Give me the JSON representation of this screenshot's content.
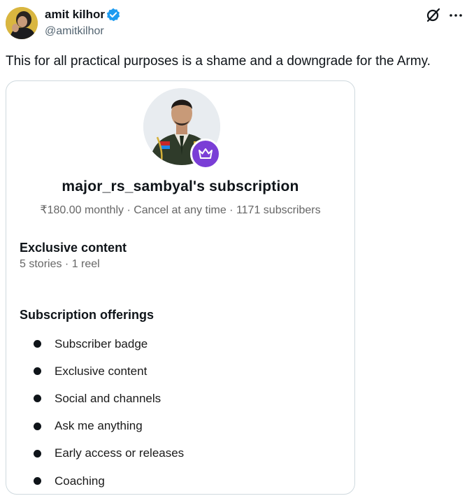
{
  "tweet": {
    "author_name": "amit kilhor",
    "author_handle": "@amitkilhor",
    "text": "This for all practical purposes is a shame and a downgrade for the Army."
  },
  "subscription_card": {
    "title": "major_rs_sambyal's subscription",
    "meta": "₹180.00 monthly · Cancel at any time · 1171 subscribers",
    "exclusive_content": {
      "heading": "Exclusive content",
      "detail": "5 stories · 1 reel"
    },
    "offerings": {
      "heading": "Subscription offerings",
      "items": [
        "Subscriber badge",
        "Exclusive content",
        "Social and channels",
        "Ask me anything",
        "Early access or releases",
        "Coaching"
      ]
    }
  },
  "icons": {
    "verified": "verified-badge-icon",
    "grok": "grok-icon",
    "more": "more-icon",
    "crown": "crown-icon"
  },
  "colors": {
    "verified_blue": "#1d9bf0",
    "crown_purple": "#7a3ed6",
    "secondary_text": "#536471",
    "border": "#cfd9de"
  }
}
